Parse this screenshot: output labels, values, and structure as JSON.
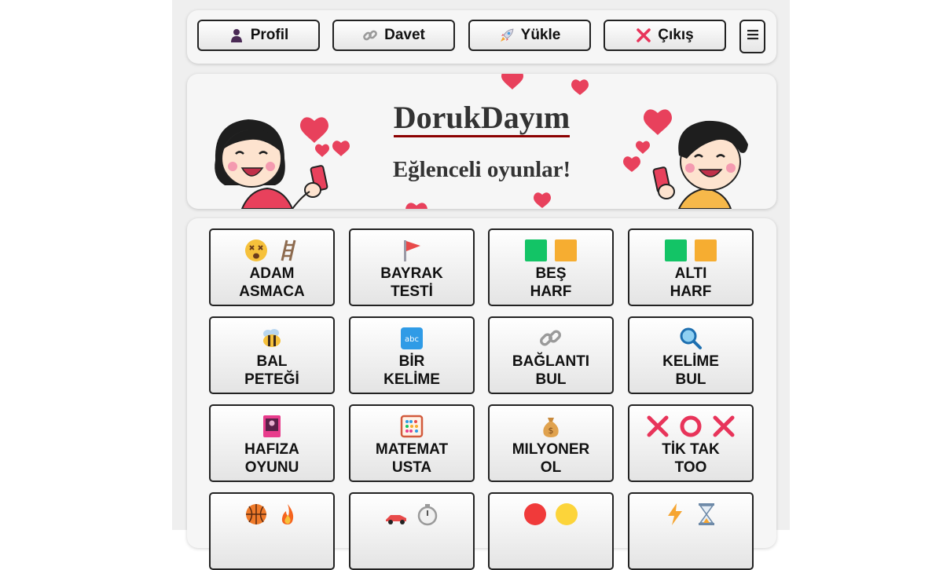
{
  "toolbar": {
    "buttons": [
      {
        "label": "Profil",
        "icon": "person-icon"
      },
      {
        "label": "Davet",
        "icon": "link-icon"
      },
      {
        "label": "Yükle",
        "icon": "rocket-icon"
      },
      {
        "label": "Çıkış",
        "icon": "cross-icon"
      }
    ],
    "menu_icon": "hamburger-menu-icon"
  },
  "banner": {
    "title": "DorukDayım",
    "subtitle": "Eğlenceli oyunlar!"
  },
  "games": [
    {
      "line1": "ADAM",
      "line2": "ASMACA",
      "icons": [
        "dizzy-face-icon",
        "ladder-icon"
      ]
    },
    {
      "line1": "BAYRAK",
      "line2": "TESTİ",
      "icons": [
        "red-flag-icon"
      ]
    },
    {
      "line1": "BEŞ",
      "line2": "HARF",
      "icons": [
        "green-square-icon",
        "orange-square-icon"
      ]
    },
    {
      "line1": "ALTI",
      "line2": "HARF",
      "icons": [
        "green-square-icon",
        "orange-square-icon"
      ]
    },
    {
      "line1": "BAL",
      "line2": "PETEĞİ",
      "icons": [
        "bee-icon"
      ]
    },
    {
      "line1": "BİR",
      "line2": "KELİME",
      "icons": [
        "abc-icon"
      ]
    },
    {
      "line1": "BAĞLANTI",
      "line2": "BUL",
      "icons": [
        "link-icon"
      ]
    },
    {
      "line1": "KELİME",
      "line2": "BUL",
      "icons": [
        "magnifier-icon"
      ]
    },
    {
      "line1": "HAFIZA",
      "line2": "OYUNU",
      "icons": [
        "card-icon"
      ]
    },
    {
      "line1": "MATEMAT",
      "line2": "USTA",
      "icons": [
        "abacus-icon"
      ]
    },
    {
      "line1": "MILYONER",
      "line2": "OL",
      "icons": [
        "money-bag-icon"
      ]
    },
    {
      "line1": "TİK TAK",
      "line2": "TOO",
      "icons": [
        "x-mark-icon",
        "o-mark-icon",
        "x-mark-icon"
      ]
    },
    {
      "line1": "",
      "line2": "",
      "icons": [
        "basketball-icon",
        "fire-icon"
      ]
    },
    {
      "line1": "",
      "line2": "",
      "icons": [
        "race-car-icon",
        "stopwatch-icon"
      ]
    },
    {
      "line1": "",
      "line2": "",
      "icons": [
        "red-circle-icon",
        "yellow-circle-icon"
      ]
    },
    {
      "line1": "",
      "line2": "",
      "icons": [
        "lightning-icon",
        "hourglass-icon"
      ]
    }
  ],
  "colors": {
    "title_underline": "#8b0000",
    "heart": "#e8415c",
    "green": "#13c466",
    "orange": "#f6ad31",
    "cross": "#e8345a"
  }
}
